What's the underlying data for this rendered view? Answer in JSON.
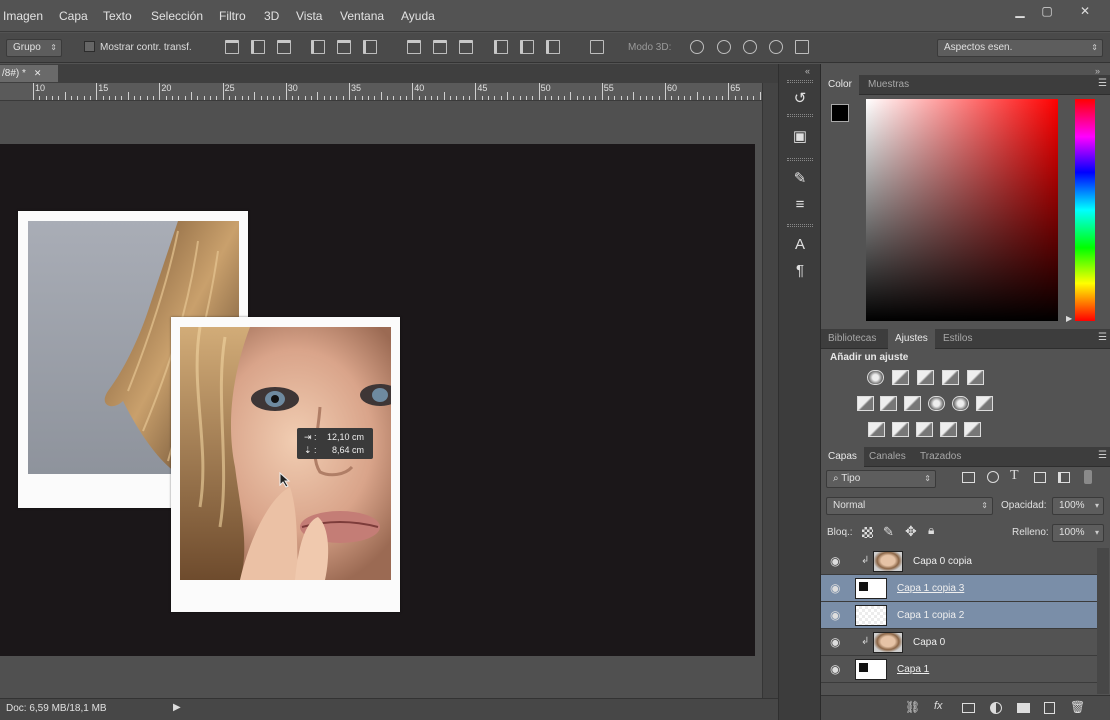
{
  "menu": {
    "items": [
      "Imagen",
      "Capa",
      "Texto",
      "Selección",
      "Filtro",
      "3D",
      "Vista",
      "Ventana",
      "Ayuda"
    ]
  },
  "window_controls": {
    "minimize": "▁",
    "maximize": "▢",
    "close": "✕"
  },
  "options_bar": {
    "group_select": "Grupo",
    "transform_checkbox_label": "Mostrar contr. transf.",
    "mode3d_label": "Modo 3D:",
    "workspace_select": "Aspectos esen."
  },
  "document": {
    "tab_label": "/8#) *",
    "ruler_ticks": [
      "10",
      "15",
      "20",
      "25",
      "30",
      "35",
      "40",
      "45",
      "50",
      "55",
      "60",
      "65"
    ],
    "measure_tooltip": {
      "width_icon": "⇥ :",
      "width_value": "12,10 cm",
      "height_icon": "⇣ :",
      "height_value": "8,64 cm"
    },
    "status": "Doc: 6,59 MB/18,1 MB"
  },
  "color_panel": {
    "tabs": [
      "Color",
      "Muestras"
    ],
    "foreground": "#000000",
    "background": "#ffffff",
    "hue": "#ff0000"
  },
  "adjustments_panel": {
    "tabs": [
      "Bibliotecas",
      "Ajustes",
      "Estilos"
    ],
    "heading": "Añadir un ajuste"
  },
  "layers_panel": {
    "tabs": [
      "Capas",
      "Canales",
      "Trazados"
    ],
    "filter_select": "Tipo",
    "blend_mode": "Normal",
    "opacity_label": "Opacidad:",
    "opacity_value": "100%",
    "lock_label": "Bloq.:",
    "fill_label": "Relleno:",
    "fill_value": "100%",
    "layers": [
      {
        "name": "Capa 0 copia",
        "thumb": "photo",
        "clipped": true,
        "selected": false,
        "underline": false
      },
      {
        "name": "Capa 1 copia 3",
        "thumb": "mask",
        "clipped": false,
        "selected": true,
        "underline": true
      },
      {
        "name": "Capa 1 copia 2",
        "thumb": "check",
        "clipped": false,
        "selected": true,
        "underline": false
      },
      {
        "name": "Capa 0",
        "thumb": "photo",
        "clipped": true,
        "selected": false,
        "underline": false
      },
      {
        "name": "Capa 1",
        "thumb": "mask",
        "clipped": false,
        "selected": false,
        "underline": true
      }
    ]
  }
}
